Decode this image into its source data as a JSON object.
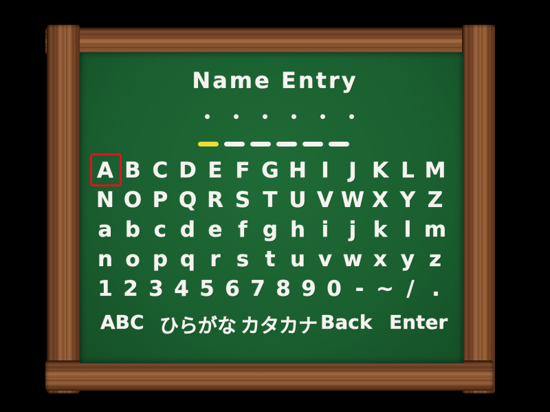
{
  "screen": {
    "title": "Name Entry",
    "name_slots": 6,
    "active_slot_index": 0,
    "selected_char": "A"
  },
  "keyboard": {
    "rows": [
      [
        "A",
        "B",
        "C",
        "D",
        "E",
        "F",
        "G",
        "H",
        "I",
        "J",
        "K",
        "L",
        "M"
      ],
      [
        "N",
        "O",
        "P",
        "Q",
        "R",
        "S",
        "T",
        "U",
        "V",
        "W",
        "X",
        "Y",
        "Z"
      ],
      [
        "a",
        "b",
        "c",
        "d",
        "e",
        "f",
        "g",
        "h",
        "i",
        "j",
        "k",
        "l",
        "m"
      ],
      [
        "n",
        "o",
        "p",
        "q",
        "r",
        "s",
        "t",
        "u",
        "v",
        "w",
        "x",
        "y",
        "z"
      ],
      [
        "1",
        "2",
        "3",
        "4",
        "5",
        "6",
        "7",
        "8",
        "9",
        "0",
        "-",
        "~",
        "/",
        "."
      ]
    ]
  },
  "modes": {
    "abc": "ABC",
    "hiragana": "ひらがな",
    "katakana": "カタカナ",
    "back": "Back",
    "enter": "Enter"
  },
  "colors": {
    "board": "#1a5f30",
    "chalk": "#f4f4ee",
    "active_underline": "#ecdc3c",
    "cursor": "#e0141e"
  }
}
